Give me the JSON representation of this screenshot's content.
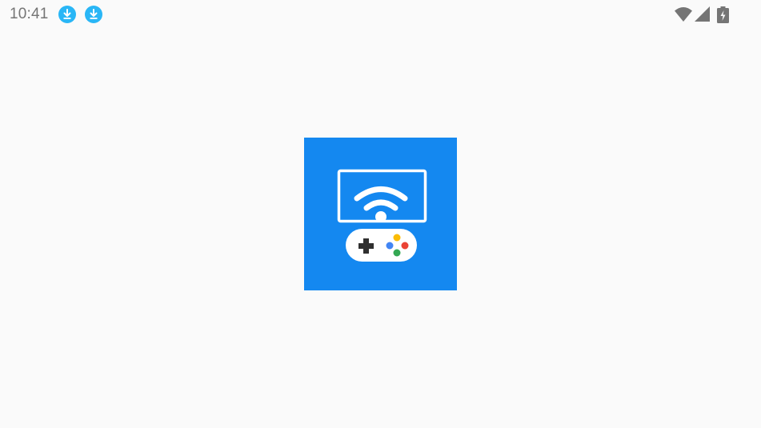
{
  "status_bar": {
    "time": "10:41",
    "notifications": [
      {
        "icon": "download-icon",
        "color": "#29b6f6"
      },
      {
        "icon": "download-icon",
        "color": "#29b6f6"
      }
    ],
    "system_icons": [
      "wifi-icon",
      "cell-signal-icon",
      "battery-charging-icon"
    ],
    "system_icon_color": "#757575"
  },
  "splash": {
    "logo_icon": "tv-cast-gamepad-logo",
    "background_color": "#1488f0"
  }
}
